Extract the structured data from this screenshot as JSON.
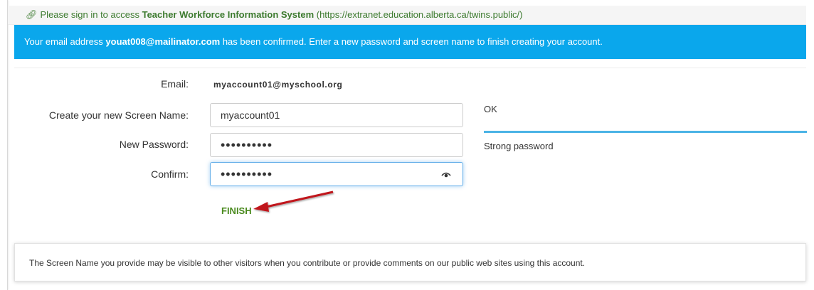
{
  "signin_bar": {
    "prefix": "Please sign in to access ",
    "app_name": "Teacher Workforce Information System",
    "url": " (https://extranet.education.alberta.ca/twins.public/)"
  },
  "info_bar": {
    "prefix": "Your email address ",
    "email": "youat008@mailinator.com",
    "suffix": " has been confirmed. Enter a new password and screen name to finish creating your account."
  },
  "form": {
    "email_label": "Email:",
    "email_value": "myaccount01@myschool.org",
    "screen_name_label": "Create your new Screen Name:",
    "screen_name_value": "myaccount01",
    "screen_name_status": "OK",
    "password_label": "New Password:",
    "password_value": "••••••••••",
    "password_strength": "Strong password",
    "password_strength_level": 1.0,
    "confirm_label": "Confirm:",
    "confirm_value": "••••••••••",
    "finish_label": "FINISH"
  },
  "note": {
    "text": "The Screen Name you provide may be visible to other visitors when you contribute or provide comments on our public web sites using this account."
  },
  "colors": {
    "info_bar_bg": "#0aa7ec",
    "link_green": "#3c7a2e",
    "finish_green": "#4a8a1e",
    "strength_bar": "#4bb4e6",
    "arrow_red": "#c0171d"
  },
  "icons": {
    "signin_link": "link-icon",
    "confirm_visibility": "eye-icon",
    "annotation": "red-arrow"
  }
}
